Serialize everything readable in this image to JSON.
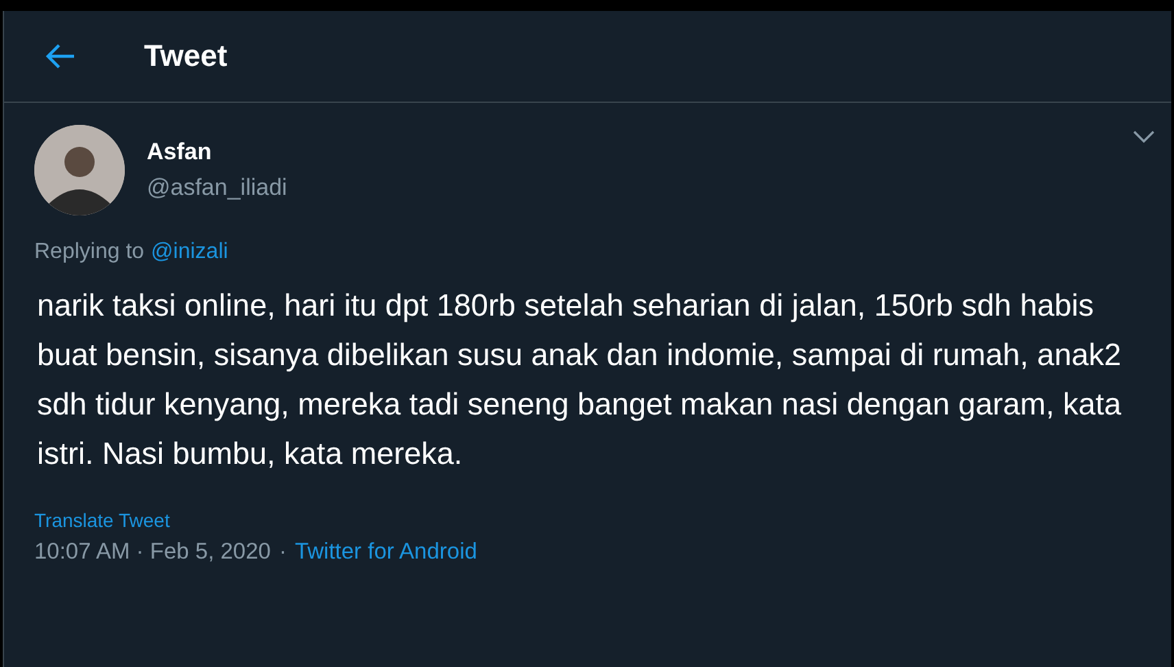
{
  "header": {
    "title": "Tweet"
  },
  "tweet": {
    "author": {
      "name": "Asfan",
      "handle": "@asfan_iliadi"
    },
    "replying_to": {
      "label": "Replying to",
      "handle": "@inizali"
    },
    "text": "narik taksi online, hari itu dpt 180rb setelah seharian di jalan, 150rb sdh habis buat bensin, sisanya dibelikan susu anak dan indomie, sampai di rumah, anak2 sdh tidur kenyang, mereka tadi seneng banget makan nasi dengan garam, kata istri. Nasi bumbu, kata mereka.",
    "translate_link": "Translate Tweet",
    "timestamp": "10:07 AM · Feb 5, 2020",
    "separator": "·",
    "source": "Twitter for Android"
  }
}
